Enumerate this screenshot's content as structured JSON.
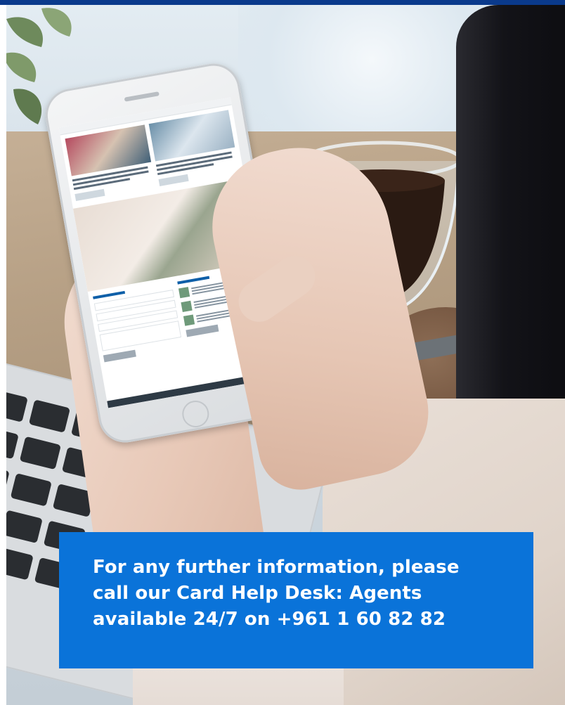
{
  "banner": {
    "info_line_1": "For any further information, please",
    "info_line_2": "call our Card Help Desk: Agents",
    "info_line_3": "available 24/7 on +961 1 60 82 82"
  },
  "colors": {
    "top_stripe": "#0a3a8c",
    "info_box_background": "#0a73d9",
    "info_text": "#ffffff"
  },
  "photo": {
    "subject": "hands-holding-smartphone-photo",
    "icons": [
      "smartphone-icon",
      "laptop-keyboard-icon",
      "coffee-glass-icon"
    ]
  }
}
